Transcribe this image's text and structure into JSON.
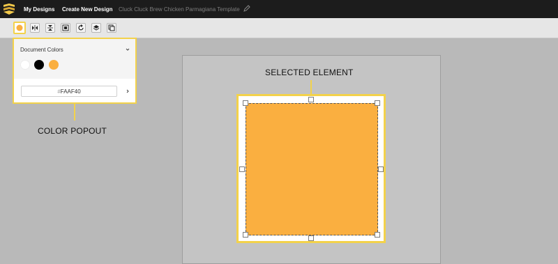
{
  "header": {
    "logo": "brand-logo",
    "nav_my_designs": "My Designs",
    "nav_create": "Create New Design",
    "doc_title": "Cluck Cluck Brew Chicken Parmagiana Template",
    "edit_icon": "pencil-icon"
  },
  "toolbar": {
    "items": [
      {
        "icon": "color-dot-icon"
      },
      {
        "icon": "flip-horizontal-icon"
      },
      {
        "icon": "flip-vertical-icon"
      },
      {
        "icon": "frame-icon"
      },
      {
        "icon": "rotate-icon"
      },
      {
        "icon": "layers-icon"
      },
      {
        "icon": "duplicate-icon"
      }
    ]
  },
  "popout": {
    "title": "Document Colors",
    "swatches": [
      {
        "color": "#FFFFFF"
      },
      {
        "color": "#000000"
      },
      {
        "color": "#FAAF40"
      }
    ],
    "hex_prefix": "#",
    "hex_value": "FAAF40"
  },
  "annotations": {
    "color_popout": "COLOR POPOUT",
    "selected_element": "SELECTED ELEMENT"
  },
  "colors": {
    "accent": "#f3d24a",
    "selected_fill": "#FAAF40"
  }
}
